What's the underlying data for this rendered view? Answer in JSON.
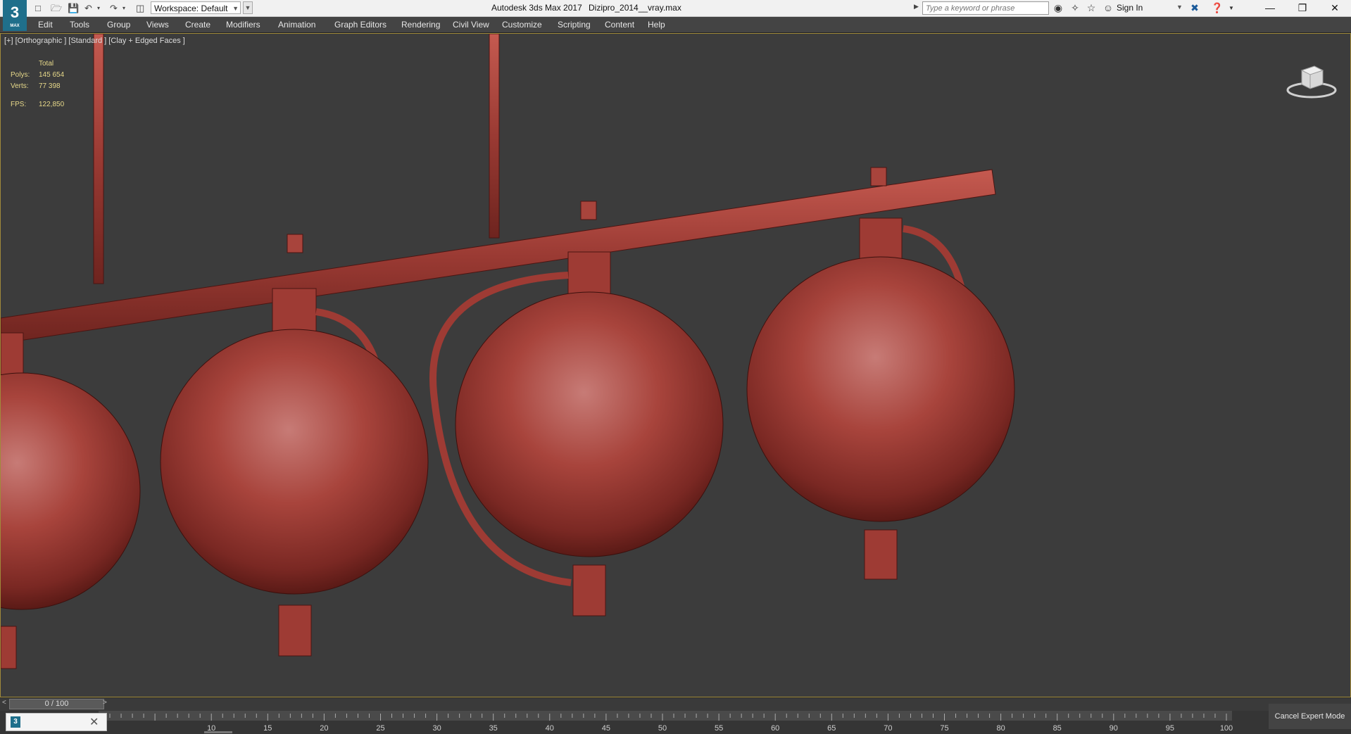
{
  "window": {
    "app_title": "Autodesk 3ds Max 2017",
    "document_title": "Dizipro_2014__vray.max",
    "workspace_label": "Workspace: Default",
    "search_placeholder": "Type a keyword or phrase",
    "sign_in": "Sign In",
    "logo_text": "3",
    "logo_sub": "MAX"
  },
  "menu": [
    "Edit",
    "Tools",
    "Group",
    "Views",
    "Create",
    "Modifiers",
    "Animation",
    "Graph Editors",
    "Rendering",
    "Civil View",
    "Customize",
    "Scripting",
    "Content",
    "Help"
  ],
  "viewport": {
    "label": "[+] [Orthographic ] [Standard ] [Clay + Edged Faces ]",
    "stats": {
      "header": "Total",
      "polys_label": "Polys:",
      "polys_value": "145 654",
      "verts_label": "Verts:",
      "verts_value": "77 398",
      "fps_label": "FPS:",
      "fps_value": "122,850"
    },
    "model_color": "#b5453b"
  },
  "timeline": {
    "frame_display": "0 / 100",
    "current_frame": 0,
    "total_frames": 100,
    "ruler_labels": [
      "10",
      "15",
      "20",
      "25",
      "30",
      "35",
      "40",
      "45",
      "50",
      "55",
      "60",
      "65",
      "70",
      "75",
      "80",
      "85",
      "90",
      "95",
      "100"
    ]
  },
  "status": {
    "cancel_expert": "Cancel Expert Mode"
  },
  "colors": {
    "menu_bg": "#444444",
    "viewport_bg": "#3c3c3c",
    "viewport_border": "#a08a3a",
    "stats_text": "#e7d98a"
  }
}
